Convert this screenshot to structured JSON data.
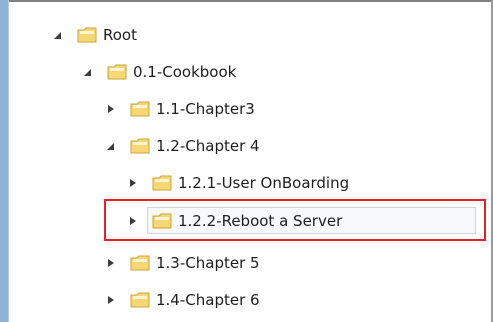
{
  "tree": {
    "nodes": [
      {
        "label": "Root",
        "state": "expanded",
        "selected": false
      },
      {
        "label": "0.1-Cookbook",
        "state": "expanded",
        "selected": false
      },
      {
        "label": "1.1-Chapter3",
        "state": "collapsed",
        "selected": false
      },
      {
        "label": "1.2-Chapter 4",
        "state": "expanded",
        "selected": false
      },
      {
        "label": "1.2.1-User OnBoarding",
        "state": "collapsed",
        "selected": false
      },
      {
        "label": "1.2.2-Reboot a Server",
        "state": "collapsed",
        "selected": true
      },
      {
        "label": "1.3-Chapter 5",
        "state": "collapsed",
        "selected": false
      },
      {
        "label": "1.4-Chapter 6",
        "state": "collapsed",
        "selected": false
      }
    ]
  },
  "icons": {
    "folder": "folder-icon",
    "expanded": "expanded-triangle-icon",
    "collapsed": "collapsed-triangle-icon"
  },
  "colors": {
    "highlight_border": "#e1222b",
    "folder_fill": "#f7d774",
    "folder_stroke": "#c9a43c",
    "toggle": "#3c3c3c"
  }
}
